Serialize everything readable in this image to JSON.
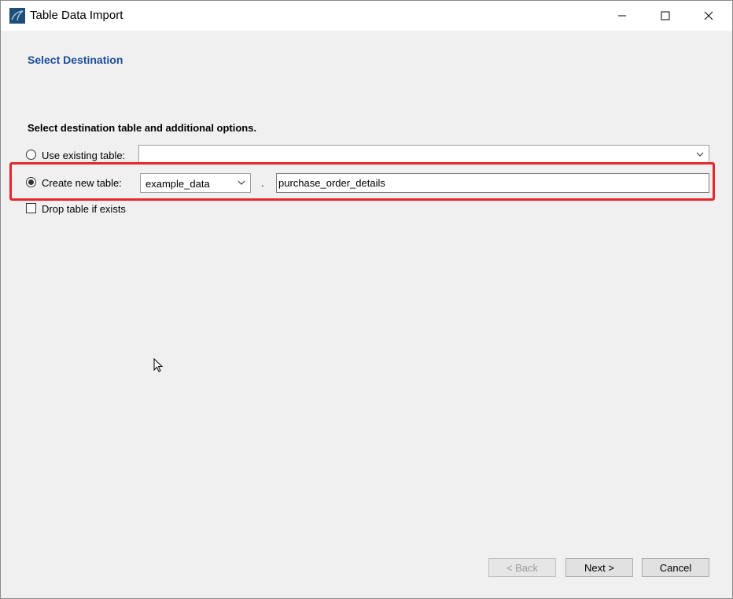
{
  "window": {
    "title": "Table Data Import",
    "controls": [
      "minimize-icon",
      "maximize-icon",
      "close-icon"
    ]
  },
  "page": {
    "heading": "Select Destination",
    "section_label": "Select destination table and additional options."
  },
  "options": {
    "use_existing": {
      "label": "Use existing table:",
      "selected": false,
      "value": ""
    },
    "create_new": {
      "label": "Create new table:",
      "selected": true,
      "schema": "example_data",
      "separator": ".",
      "table_name": "purchase_order_details"
    },
    "drop_table": {
      "label": "Drop table if exists",
      "checked": false
    }
  },
  "buttons": {
    "back": "< Back",
    "next": "Next >",
    "cancel": "Cancel"
  },
  "colors": {
    "heading": "#1c4d9b",
    "highlight": "#e8262b",
    "background": "#f0f0f0"
  }
}
